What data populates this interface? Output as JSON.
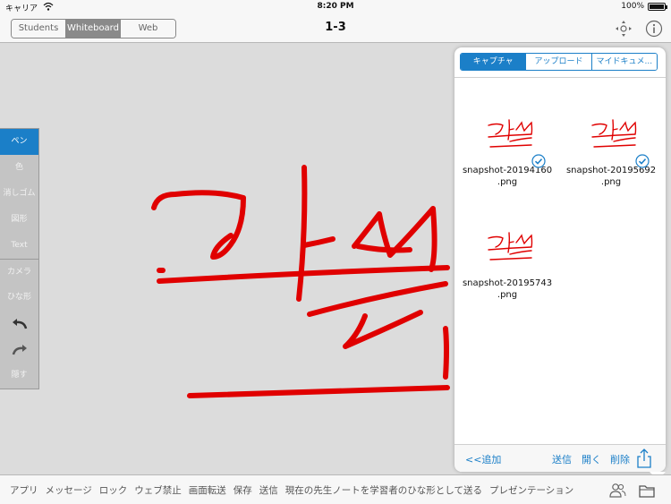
{
  "status_bar": {
    "carrier": "キャリア",
    "time": "8:20 PM",
    "battery": "100%"
  },
  "nav": {
    "title": "1-3",
    "segments": [
      "Students",
      "Whiteboard",
      "Web"
    ],
    "selected_segment": "Whiteboard"
  },
  "tools": {
    "pen": "ペン",
    "color": "色",
    "eraser": "消しゴム",
    "shape": "図形",
    "text": "Text",
    "camera": "カメラ",
    "template": "ひな形",
    "hide": "隠す"
  },
  "panel": {
    "tabs": [
      "キャプチャ",
      "アップロード",
      "マイドキュメ..."
    ],
    "selected_tab": "キャプチャ",
    "snapshots": [
      {
        "name": "snapshot-20194160",
        "ext": ".png",
        "checked": true
      },
      {
        "name": "snapshot-20195692",
        "ext": ".png",
        "checked": true
      },
      {
        "name": "snapshot-20195743",
        "ext": ".png",
        "checked": false
      }
    ],
    "footer": {
      "add": "<<追加",
      "send": "送信",
      "open": "開く",
      "delete": "削除"
    }
  },
  "bottom_bar": {
    "items": [
      "アプリ",
      "メッセージ",
      "ロック",
      "ウェブ禁止",
      "画面転送",
      "保存",
      "送信",
      "現在の先生ノートを学習者のひな形として送る",
      "プレゼンテーション"
    ]
  },
  "colors": {
    "accent": "#1b7fc8",
    "ink": "#e00000",
    "selected_segment": "#8a8a8a"
  }
}
